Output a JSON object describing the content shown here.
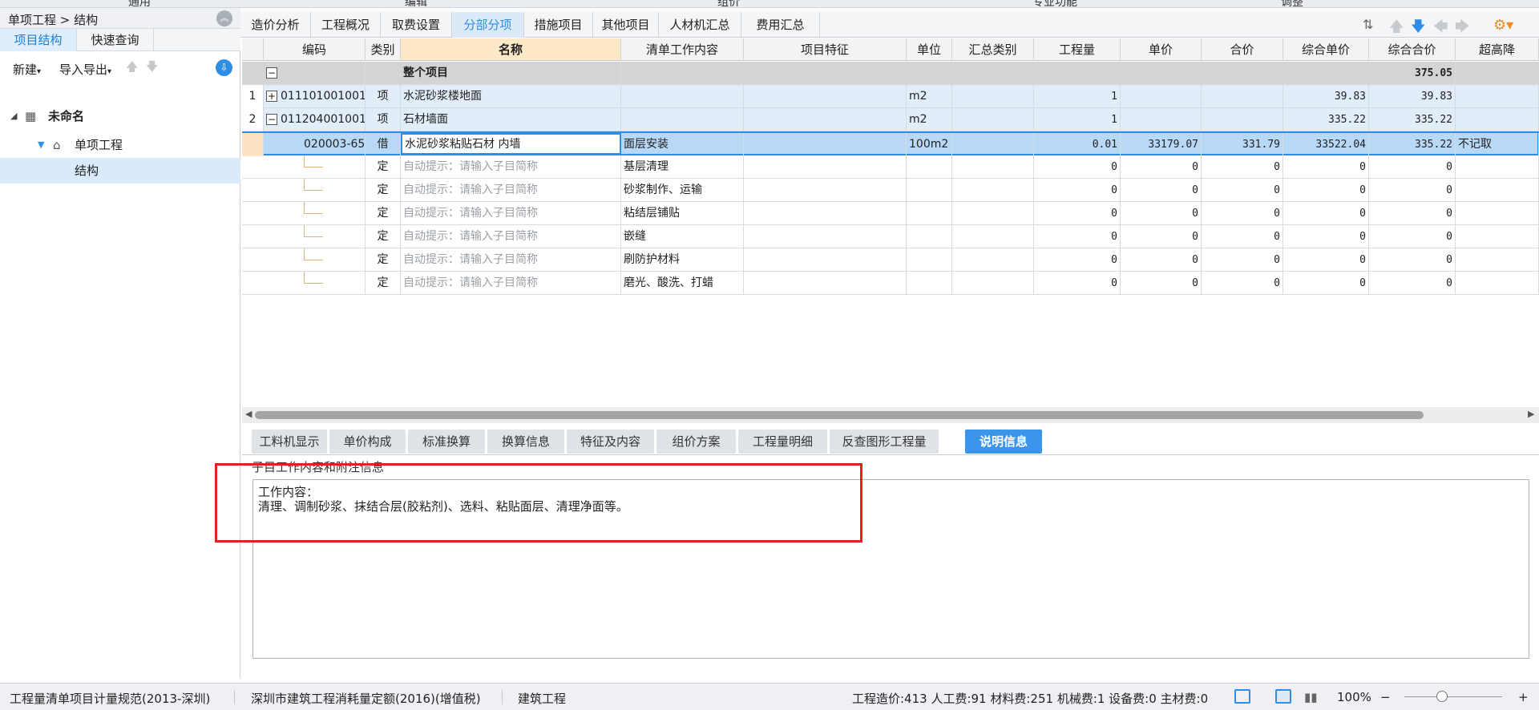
{
  "ribbon": {
    "groups": [
      "通用",
      "编辑",
      "组价",
      "专业功能",
      "调整"
    ]
  },
  "left_panel": {
    "breadcrumb": "单项工程 > 结构",
    "tabs": [
      "项目结构",
      "快速查询"
    ],
    "toolbar": {
      "new_label": "新建",
      "import_export_label": "导入导出"
    },
    "tree": {
      "root": "未命名",
      "child": "单项工程",
      "leaf": "结构"
    }
  },
  "main_tabs": [
    "造价分析",
    "工程概况",
    "取费设置",
    "分部分项",
    "措施项目",
    "其他项目",
    "人材机汇总",
    "费用汇总"
  ],
  "active_main_tab": "分部分项",
  "grid": {
    "headers": [
      "编码",
      "类别",
      "名称",
      "清单工作内容",
      "项目特征",
      "单位",
      "汇总类别",
      "工程量",
      "单价",
      "合价",
      "综合单价",
      "综合合价",
      "超高降"
    ],
    "whole_row": {
      "name": "整个项目",
      "total": "375.05"
    },
    "rows": [
      {
        "no": "1",
        "code": "011101001001",
        "type": "项",
        "name": "水泥砂浆楼地面",
        "content": "",
        "unit": "m2",
        "qty": "1",
        "price": "",
        "amount": "",
        "comp_price": "39.83",
        "comp_amount": "39.83",
        "extra": ""
      },
      {
        "no": "2",
        "code": "011204001001",
        "type": "项",
        "name": "石材墙面",
        "content": "",
        "unit": "m2",
        "qty": "1",
        "price": "",
        "amount": "",
        "comp_price": "335.22",
        "comp_amount": "335.22",
        "extra": ""
      },
      {
        "no": "",
        "code": "020003-65",
        "type": "借",
        "name": "水泥砂浆粘贴石材 内墙",
        "content": "面层安装",
        "unit": "100m2",
        "qty": "0.01",
        "price": "33179.07",
        "amount": "331.79",
        "comp_price": "33522.04",
        "comp_amount": "335.22",
        "extra": "不记取"
      }
    ],
    "sub_rows": [
      {
        "type": "定",
        "name": "自动提示：请输入子目简称",
        "content": "基层清理",
        "qty": "0",
        "price": "0",
        "amount": "0",
        "comp_price": "0",
        "comp_amount": "0"
      },
      {
        "type": "定",
        "name": "自动提示：请输入子目简称",
        "content": "砂浆制作、运输",
        "qty": "0",
        "price": "0",
        "amount": "0",
        "comp_price": "0",
        "comp_amount": "0"
      },
      {
        "type": "定",
        "name": "自动提示：请输入子目简称",
        "content": "粘结层铺贴",
        "qty": "0",
        "price": "0",
        "amount": "0",
        "comp_price": "0",
        "comp_amount": "0"
      },
      {
        "type": "定",
        "name": "自动提示：请输入子目简称",
        "content": "嵌缝",
        "qty": "0",
        "price": "0",
        "amount": "0",
        "comp_price": "0",
        "comp_amount": "0"
      },
      {
        "type": "定",
        "name": "自动提示：请输入子目简称",
        "content": "刷防护材料",
        "qty": "0",
        "price": "0",
        "amount": "0",
        "comp_price": "0",
        "comp_amount": "0"
      },
      {
        "type": "定",
        "name": "自动提示：请输入子目简称",
        "content": "磨光、酸洗、打蜡",
        "qty": "0",
        "price": "0",
        "amount": "0",
        "comp_price": "0",
        "comp_amount": "0"
      }
    ]
  },
  "bottom_tabs": [
    "工料机显示",
    "单价构成",
    "标准换算",
    "换算信息",
    "特征及内容",
    "组价方案",
    "工程量明细",
    "反查图形工程量",
    "说明信息"
  ],
  "active_bottom_tab": "说明信息",
  "info": {
    "title": "子目工作内容和附注信息",
    "line1": "工作内容：",
    "line2": "清理、调制砂浆、抹结合层(胶粘剂)、选料、粘贴面层、清理净面等。"
  },
  "status": {
    "standard": "工程量清单项目计量规范(2013-深圳)",
    "quota": "深圳市建筑工程消耗量定额(2016)(增值税)",
    "discipline": "建筑工程",
    "summary": "工程造价:413  人工费:91  材料费:251  机械费:1  设备费:0  主材费:0",
    "zoom": "100%"
  },
  "colors": {
    "accent": "#2e8de6",
    "highlight_row": "#b8d8f7",
    "name_header": "#fde8c8",
    "annotation": "#e51e1e"
  }
}
